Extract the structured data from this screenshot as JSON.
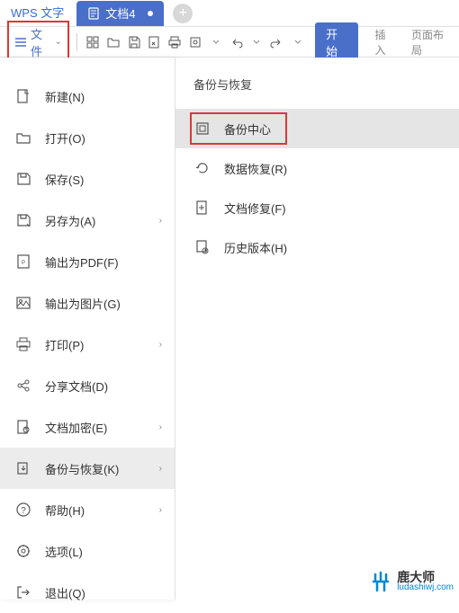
{
  "tabs": {
    "wps_label": "WPS 文字",
    "doc_label": "文档4"
  },
  "toolbar": {
    "file_label": "文件",
    "start_label": "开始",
    "insert_label": "插入",
    "layout_label": "页面布局"
  },
  "file_menu": [
    {
      "label": "新建(N)",
      "icon": "new"
    },
    {
      "label": "打开(O)",
      "icon": "open"
    },
    {
      "label": "保存(S)",
      "icon": "save"
    },
    {
      "label": "另存为(A)",
      "icon": "saveas",
      "arrow": true
    },
    {
      "label": "输出为PDF(F)",
      "icon": "pdf"
    },
    {
      "label": "输出为图片(G)",
      "icon": "image"
    },
    {
      "label": "打印(P)",
      "icon": "print",
      "arrow": true
    },
    {
      "label": "分享文档(D)",
      "icon": "share"
    },
    {
      "label": "文档加密(E)",
      "icon": "encrypt",
      "arrow": true
    },
    {
      "label": "备份与恢复(K)",
      "icon": "backup",
      "arrow": true,
      "active": true
    },
    {
      "label": "帮助(H)",
      "icon": "help",
      "arrow": true
    },
    {
      "label": "选项(L)",
      "icon": "options"
    },
    {
      "label": "退出(Q)",
      "icon": "exit"
    }
  ],
  "submenu": {
    "title": "备份与恢复",
    "items": [
      {
        "label": "备份中心",
        "icon": "backup-center",
        "highlight": true
      },
      {
        "label": "数据恢复(R)",
        "icon": "data-recover"
      },
      {
        "label": "文档修复(F)",
        "icon": "doc-repair"
      },
      {
        "label": "历史版本(H)",
        "icon": "history"
      }
    ]
  },
  "watermark": {
    "brand": "鹿大师",
    "url": "ludashiwj.com"
  }
}
